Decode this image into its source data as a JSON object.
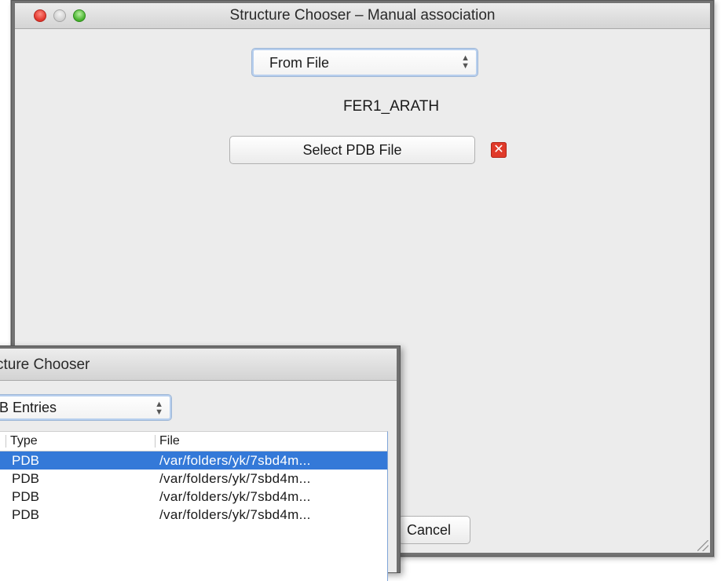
{
  "main_window": {
    "title": "Structure Chooser – Manual association",
    "source_select": {
      "value": "From File"
    },
    "sequence_name": "FER1_ARATH",
    "select_pdb_button": "Select PDB File",
    "cancel_button": "Cancel",
    "remove_icon": "close-icon"
  },
  "second_window": {
    "title": "cture Chooser",
    "entries_select": {
      "value": "DB Entries"
    },
    "table": {
      "columns": [
        "Type",
        "File"
      ],
      "rows": [
        {
          "type": "PDB",
          "file": "/var/folders/yk/7sbd4m...",
          "selected": true
        },
        {
          "type": "PDB",
          "file": "/var/folders/yk/7sbd4m...",
          "selected": false
        },
        {
          "type": "PDB",
          "file": "/var/folders/yk/7sbd4m...",
          "selected": false
        },
        {
          "type": "PDB",
          "file": "/var/folders/yk/7sbd4m...",
          "selected": false
        }
      ]
    }
  },
  "colors": {
    "selection": "#3479d8",
    "window_bg": "#ececec",
    "remove_icon": "#e03a2a"
  }
}
